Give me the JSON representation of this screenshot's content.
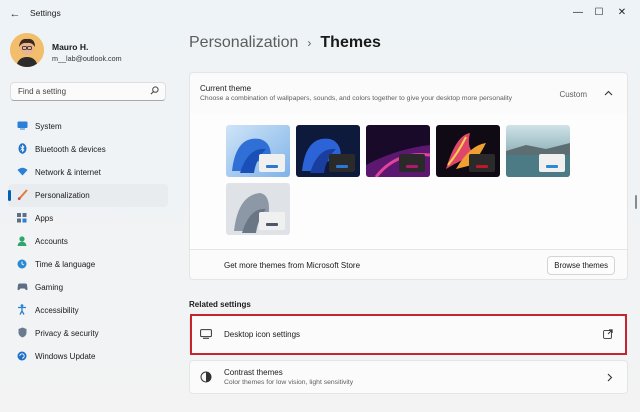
{
  "window": {
    "title": "Settings"
  },
  "user": {
    "name": "Mauro H.",
    "email": "m__lab@outlook.com"
  },
  "search": {
    "placeholder": "Find a setting"
  },
  "sidebar": {
    "items": [
      {
        "label": "System",
        "icon": "monitor-icon"
      },
      {
        "label": "Bluetooth & devices",
        "icon": "bluetooth-icon"
      },
      {
        "label": "Network & internet",
        "icon": "wifi-icon"
      },
      {
        "label": "Personalization",
        "icon": "brush-icon",
        "active": true
      },
      {
        "label": "Apps",
        "icon": "apps-icon"
      },
      {
        "label": "Accounts",
        "icon": "person-icon"
      },
      {
        "label": "Time & language",
        "icon": "globe-clock-icon"
      },
      {
        "label": "Gaming",
        "icon": "gamepad-icon"
      },
      {
        "label": "Accessibility",
        "icon": "accessibility-icon"
      },
      {
        "label": "Privacy & security",
        "icon": "shield-icon"
      },
      {
        "label": "Windows Update",
        "icon": "update-icon"
      }
    ]
  },
  "breadcrumb": {
    "parent": "Personalization",
    "separator": "›",
    "current": "Themes"
  },
  "current_theme": {
    "title": "Current theme",
    "description": "Choose a combination of wallpapers, sounds, and colors together to give your desktop more personality",
    "value": "Custom",
    "themes": [
      {
        "name": "windows-light-bloom",
        "bar_color": "#2b78d4"
      },
      {
        "name": "windows-dark-bloom",
        "bar_color": "#2b78d4"
      },
      {
        "name": "glow",
        "bar_color": "#b3176b"
      },
      {
        "name": "captured-motion",
        "bar_color": "#c0172a"
      },
      {
        "name": "sunrise-lake",
        "bar_color": "#2b8ad4"
      },
      {
        "name": "flow",
        "bar_color": "#4a5868"
      }
    ],
    "store_text": "Get more themes from Microsoft Store",
    "browse_label": "Browse themes"
  },
  "related": {
    "title": "Related settings",
    "desktop_icon": {
      "label": "Desktop icon settings",
      "icon": "open-external-icon"
    },
    "contrast": {
      "label": "Contrast themes",
      "description": "Color themes for low vision, light sensitivity",
      "icon": "contrast-icon"
    }
  },
  "colors": {
    "accent": "#005fb8",
    "highlight": "#c4262e"
  }
}
